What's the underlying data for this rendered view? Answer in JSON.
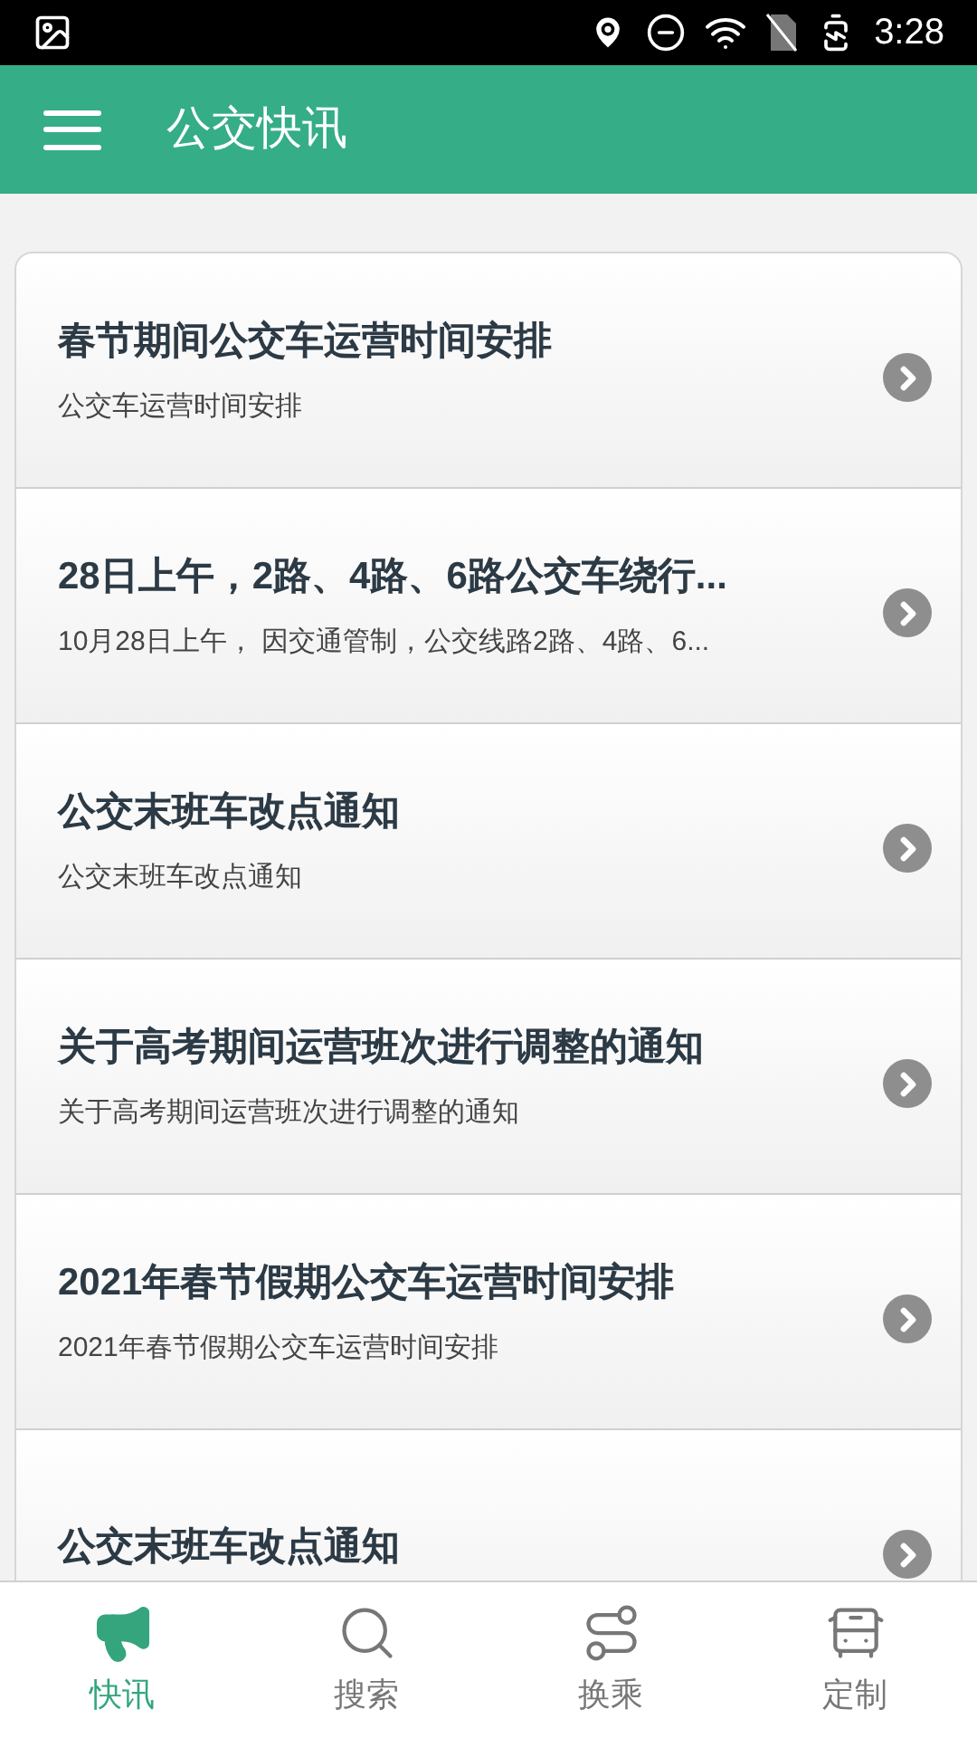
{
  "status_bar": {
    "time": "3:28"
  },
  "app_bar": {
    "title": "公交快讯"
  },
  "news": [
    {
      "title": "春节期间公交车运营时间安排",
      "summary": "公交车运营时间安排"
    },
    {
      "title": "28日上午，2路、4路、6路公交车绕行...",
      "summary": "10月28日上午， 因交通管制，公交线路2路、4路、6..."
    },
    {
      "title": "公交末班车改点通知",
      "summary": "公交末班车改点通知"
    },
    {
      "title": "关于高考期间运营班次进行调整的通知",
      "summary": "关于高考期间运营班次进行调整的通知"
    },
    {
      "title": "2021年春节假期公交车运营时间安排",
      "summary": "2021年春节假期公交车运营时间安排"
    },
    {
      "title": "公交末班车改点通知"
    }
  ],
  "bottom_nav": [
    {
      "label": "快讯",
      "kind": "news",
      "selected": true
    },
    {
      "label": "搜索",
      "kind": "search",
      "selected": false
    },
    {
      "label": "换乘",
      "kind": "transfer",
      "selected": false
    },
    {
      "label": "定制",
      "kind": "bus",
      "selected": false
    }
  ]
}
